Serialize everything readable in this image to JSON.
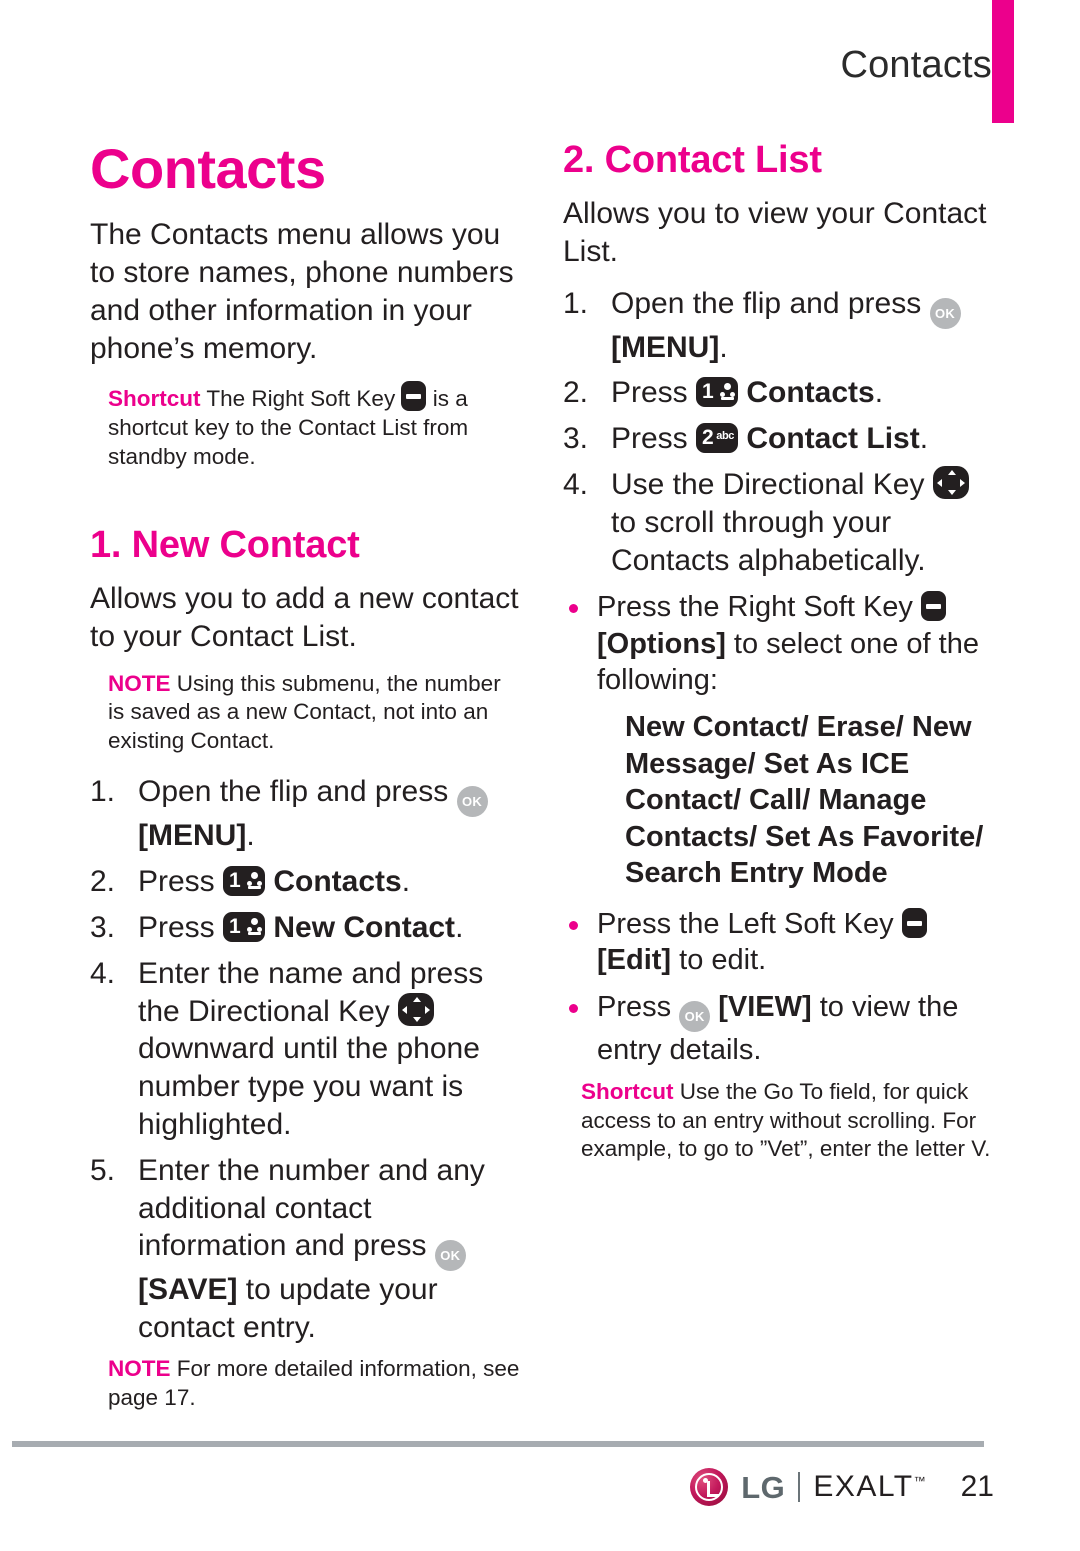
{
  "header": {
    "running_title": "Contacts",
    "accent_color": "#ec008c"
  },
  "left_column": {
    "chapter_title": "Contacts",
    "intro": "The Contacts menu allows you to store names, phone numbers and other information in your phone’s memory.",
    "shortcut_note": {
      "tag": "Shortcut",
      "text_before_icon": " The Right Soft Key ",
      "icon": "right-soft-key-icon",
      "text_after_icon": " is a shortcut key to the Contact List from standby mode."
    },
    "section": {
      "title": "1. New Contact",
      "intro": "Allows you to add a new contact to your Contact List.",
      "note": {
        "tag": "NOTE",
        "text": " Using this submenu, the number is saved as a new Contact, not into an existing Contact."
      },
      "steps": [
        {
          "num": "1.",
          "parts": [
            {
              "t": "text",
              "v": "Open the flip and press "
            },
            {
              "t": "icon",
              "v": "ok-key-icon"
            },
            {
              "t": "bold",
              "v": " [MENU]"
            },
            {
              "t": "text",
              "v": "."
            }
          ]
        },
        {
          "num": "2.",
          "parts": [
            {
              "t": "text",
              "v": "Press "
            },
            {
              "t": "icon",
              "v": "key-1-icon"
            },
            {
              "t": "bold",
              "v": " Contacts"
            },
            {
              "t": "text",
              "v": "."
            }
          ]
        },
        {
          "num": "3.",
          "parts": [
            {
              "t": "text",
              "v": "Press "
            },
            {
              "t": "icon",
              "v": "key-1-icon"
            },
            {
              "t": "bold",
              "v": " New Contact"
            },
            {
              "t": "text",
              "v": "."
            }
          ]
        },
        {
          "num": "4.",
          "parts": [
            {
              "t": "text",
              "v": "Enter the name and press the Directional Key "
            },
            {
              "t": "icon",
              "v": "directional-key-icon"
            },
            {
              "t": "text",
              "v": " downward until the phone number type you want is highlighted."
            }
          ]
        },
        {
          "num": "5.",
          "parts": [
            {
              "t": "text",
              "v": "Enter the number and any additional contact information and press "
            },
            {
              "t": "icon",
              "v": "ok-key-icon"
            },
            {
              "t": "bold",
              "v": " [SAVE]"
            },
            {
              "t": "text",
              "v": " to update your contact entry."
            }
          ]
        }
      ],
      "footer_note": {
        "tag": "NOTE",
        "text": " For more detailed information, see page 17."
      }
    }
  },
  "right_column": {
    "section": {
      "title": "2. Contact List",
      "intro": "Allows you to view your Contact List.",
      "steps": [
        {
          "num": "1.",
          "parts": [
            {
              "t": "text",
              "v": "Open the flip and press "
            },
            {
              "t": "icon",
              "v": "ok-key-icon"
            },
            {
              "t": "bold",
              "v": " [MENU]"
            },
            {
              "t": "text",
              "v": "."
            }
          ]
        },
        {
          "num": "2.",
          "parts": [
            {
              "t": "text",
              "v": "Press "
            },
            {
              "t": "icon",
              "v": "key-1-icon"
            },
            {
              "t": "bold",
              "v": " Contacts"
            },
            {
              "t": "text",
              "v": "."
            }
          ]
        },
        {
          "num": "3.",
          "parts": [
            {
              "t": "text",
              "v": "Press "
            },
            {
              "t": "icon",
              "v": "key-2-icon"
            },
            {
              "t": "bold",
              "v": " Contact List"
            },
            {
              "t": "text",
              "v": "."
            }
          ]
        },
        {
          "num": "4.",
          "parts": [
            {
              "t": "text",
              "v": "Use the Directional Key "
            },
            {
              "t": "icon",
              "v": "directional-key-icon"
            },
            {
              "t": "text",
              "v": " to scroll through your Contacts alphabetically."
            }
          ]
        }
      ],
      "bullets": [
        {
          "parts": [
            {
              "t": "text",
              "v": "Press the Right Soft Key "
            },
            {
              "t": "icon",
              "v": "right-soft-key-icon"
            },
            {
              "t": "bold",
              "v": " [Options]"
            },
            {
              "t": "text",
              "v": " to select one of the following:"
            }
          ]
        }
      ],
      "options": "New Contact/ Erase/ New Message/ Set As ICE Contact/ Call/ Manage Contacts/ Set As Favorite/ Search Entry Mode",
      "bullets_after": [
        {
          "parts": [
            {
              "t": "text",
              "v": "Press the Left Soft Key "
            },
            {
              "t": "icon",
              "v": "left-soft-key-icon"
            },
            {
              "t": "bold",
              "v": " [Edit]"
            },
            {
              "t": "text",
              "v": " to edit."
            }
          ]
        },
        {
          "parts": [
            {
              "t": "text",
              "v": "Press "
            },
            {
              "t": "icon",
              "v": "ok-key-icon"
            },
            {
              "t": "bold",
              "v": " [VIEW]"
            },
            {
              "t": "text",
              "v": " to view the entry details."
            }
          ]
        }
      ],
      "shortcut_note": {
        "tag": "Shortcut",
        "text": " Use the Go To field, for quick access to an entry without scrolling. For example, to go to ”Vet”, enter the letter V."
      }
    }
  },
  "footer": {
    "brand": "LG",
    "product": "EXALT",
    "trademark": "™",
    "page_number": "21"
  },
  "icons": {
    "ok-key-icon": "OK",
    "key-1-icon": "1",
    "key-2-icon": "2",
    "key-2-legend": "abc",
    "right-soft-key-icon": "soft-key",
    "left-soft-key-icon": "soft-key",
    "directional-key-icon": "d-pad"
  }
}
